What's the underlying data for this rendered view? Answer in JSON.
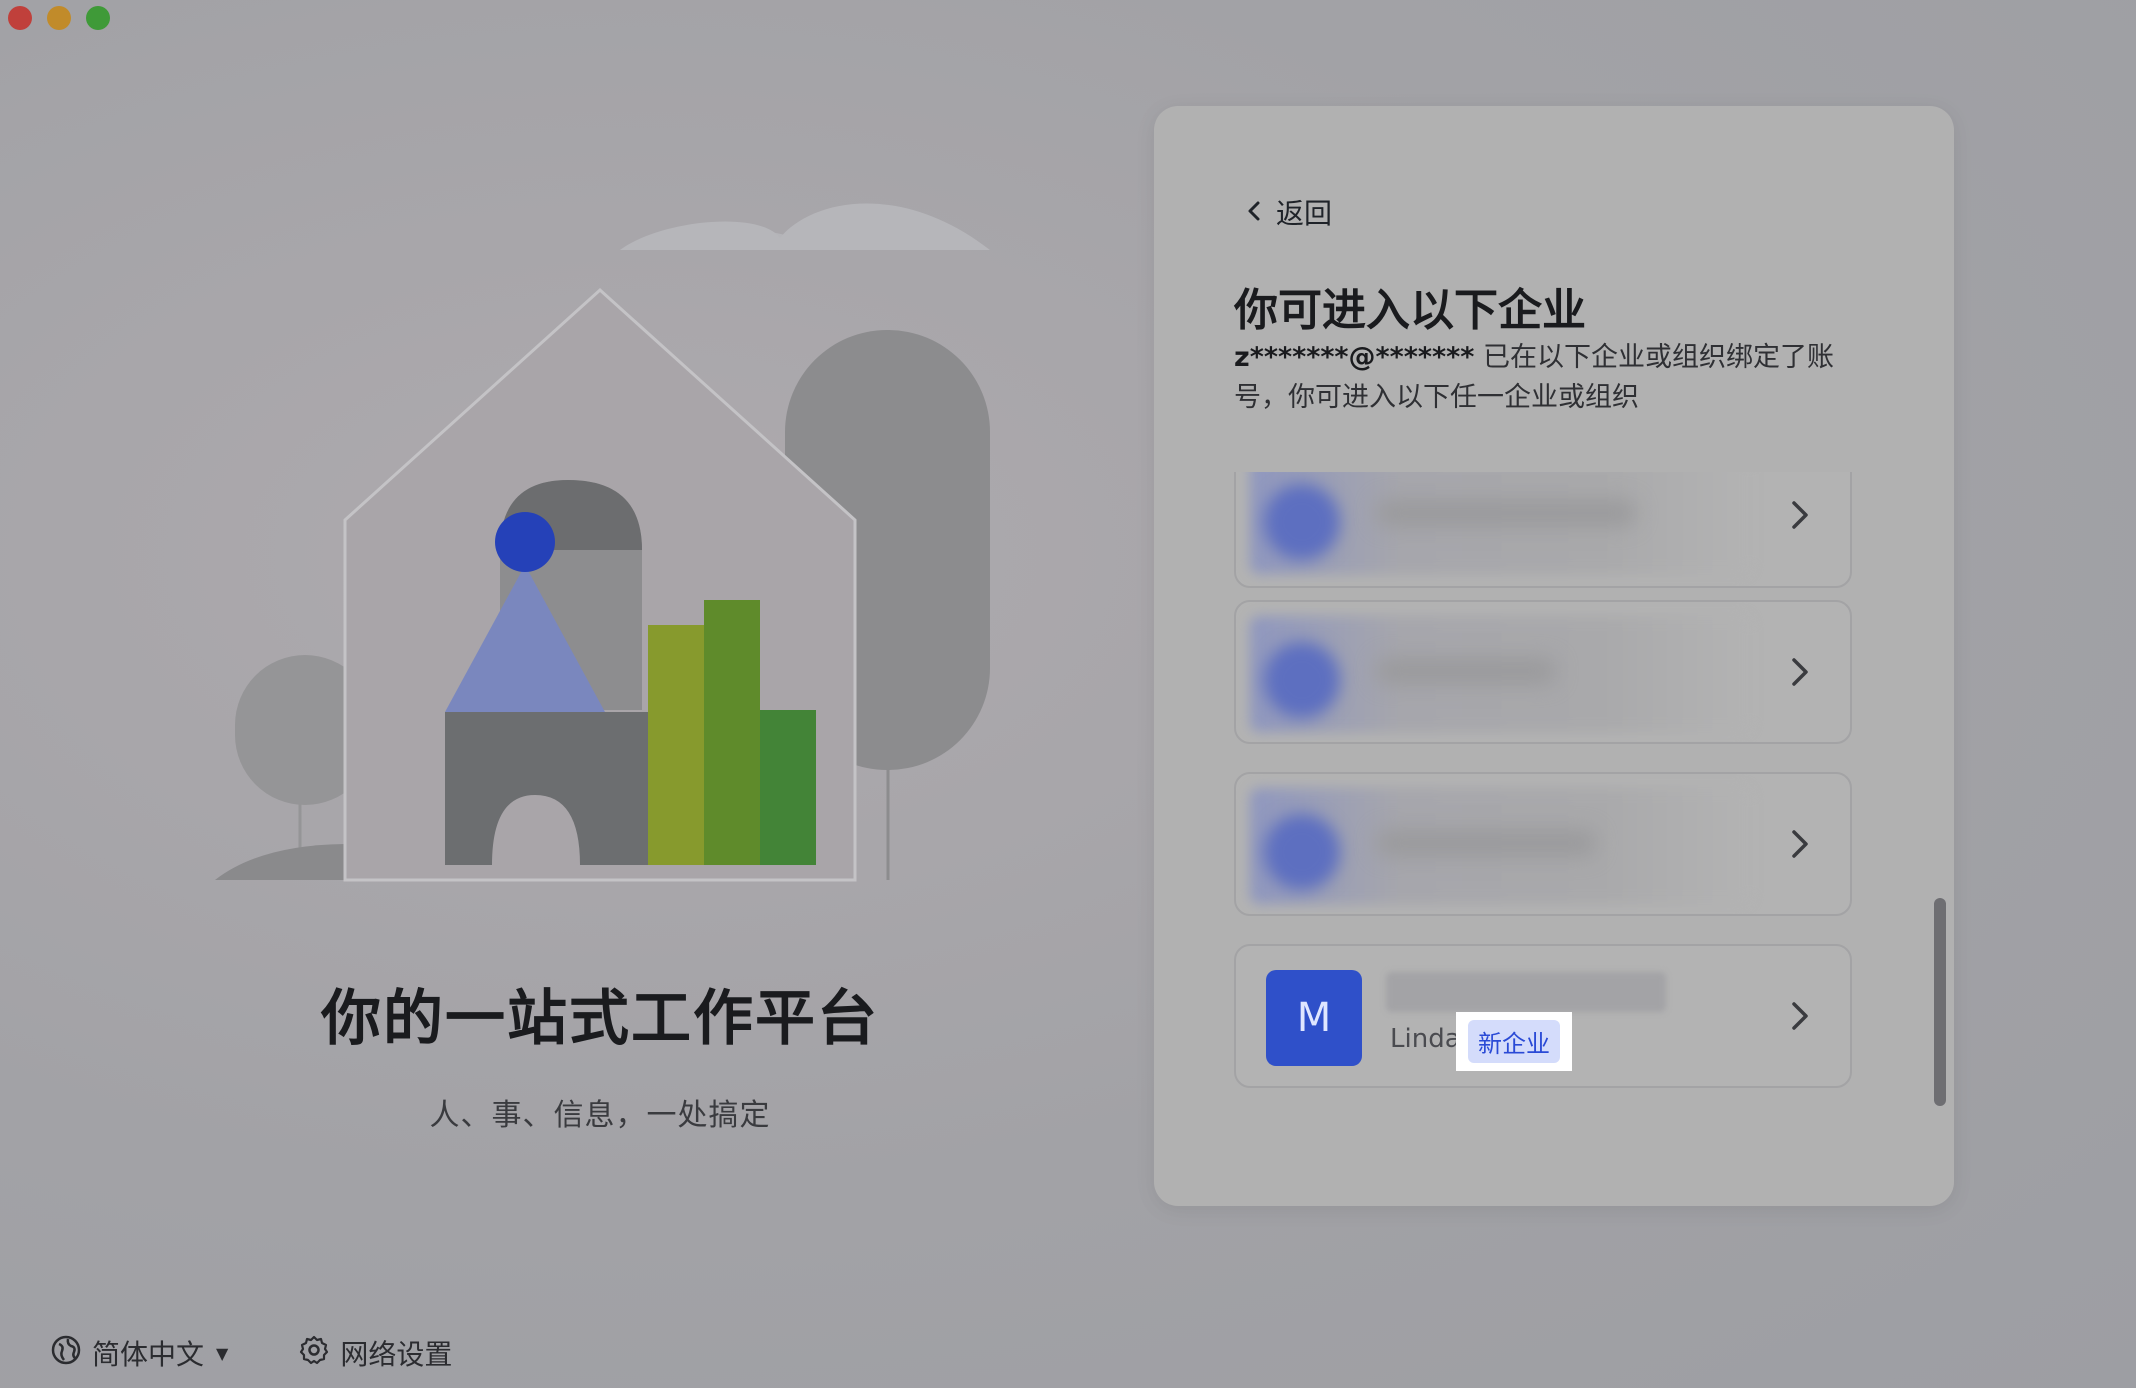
{
  "window": {
    "controls": [
      "close",
      "minimize",
      "maximize"
    ]
  },
  "hero": {
    "title": "你的一站式工作平台",
    "subtitle": "人、事、信息，一处搞定"
  },
  "bottom_bar": {
    "language_label": "简体中文",
    "language_icon": "globe-icon",
    "network_label": "网络设置",
    "network_icon": "gear-icon"
  },
  "card": {
    "back_label": "返回",
    "title": "你可进入以下企业",
    "account_masked": "z*******@*******",
    "description_rest": "已在以下企业或组织绑定了账号，你可进入以下任一企业或组织",
    "organizations": [
      {
        "blurred": true
      },
      {
        "blurred": true
      },
      {
        "blurred": true
      },
      {
        "avatar_letter": "M",
        "owner": "Linda",
        "tag": "新企业",
        "blurred_name": true
      }
    ]
  },
  "colors": {
    "accent": "#2f50c9",
    "tag_bg": "#d4dcfb",
    "tag_text": "#2a4ad6",
    "card_bg": "#b1b1b1"
  }
}
